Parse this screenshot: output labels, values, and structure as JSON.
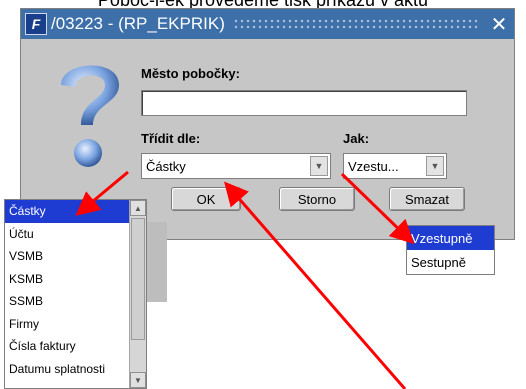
{
  "caption": "Poboč-l-ek provedeme tisk příkazů v aktu",
  "window": {
    "title": "/03223 - (RP_EKPRIK)",
    "app_icon_glyph": "F",
    "close_glyph": "✕"
  },
  "form": {
    "city_label": "Město pobočky:",
    "city_value": "",
    "sort_label": "Třídit dle:",
    "sort_selected": "Částky",
    "how_label": "Jak:",
    "how_selected": "Vzestu..."
  },
  "buttons": {
    "ok": "OK",
    "cancel": "Storno",
    "clear": "Smazat"
  },
  "sort_options": [
    "Částky",
    "Účtu",
    "VSMB",
    "KSMB",
    "SSMB",
    "Firmy",
    "Čísla faktury",
    "Datumu splatnosti"
  ],
  "order_options": [
    "Vzestupně",
    "Sestupně"
  ],
  "colors": {
    "accent": "#1f3cd2",
    "arrow": "#ff0000",
    "titlebar": "#3d6fa8"
  }
}
